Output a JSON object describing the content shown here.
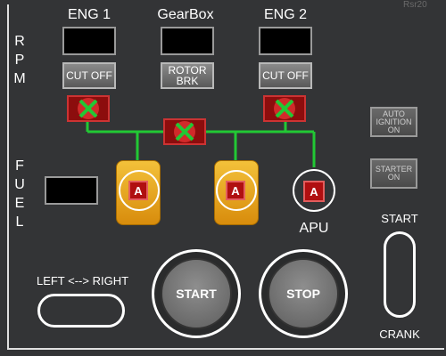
{
  "watermark": "Rsr20",
  "headers": {
    "eng1": "ENG 1",
    "gearbox": "GearBox",
    "eng2": "ENG 2"
  },
  "side_labels": {
    "rpm": [
      "R",
      "P",
      "M"
    ],
    "fuel": [
      "F",
      "U",
      "E",
      "L"
    ]
  },
  "buttons": {
    "cutoff_left": "CUT OFF",
    "rotor_brk": [
      "ROTOR",
      "BRK"
    ],
    "cutoff_right": "CUT OFF",
    "auto_ignition": [
      "AUTO",
      "IGNITION",
      "ON"
    ],
    "starter": [
      "STARTER",
      "ON"
    ],
    "fuel_pump_label": "A",
    "start": "START",
    "stop": "STOP"
  },
  "labels": {
    "apu": "APU",
    "left_right": "LEFT <--> RIGHT",
    "start_crank_top": "START",
    "start_crank_bottom": "CRANK"
  },
  "colors": {
    "line": "#22c834",
    "valve_x": "#22c834",
    "pump_red": "#b00f10",
    "amber": "#e3a425"
  }
}
